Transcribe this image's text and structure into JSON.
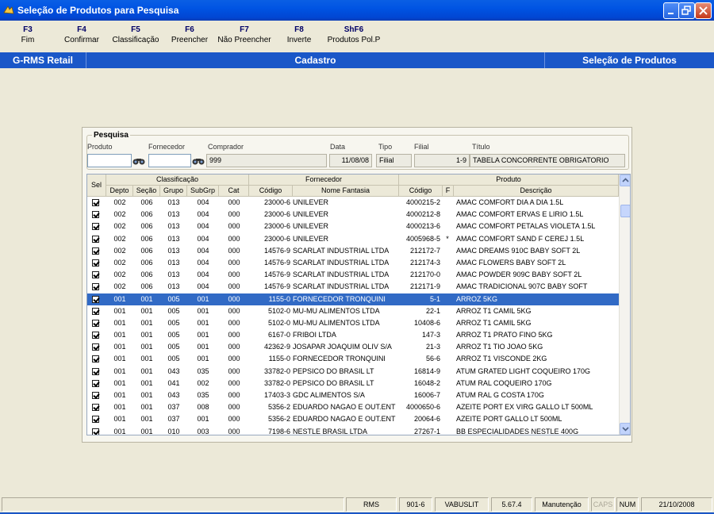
{
  "window": {
    "title": "Seleção de Produtos para Pesquisa"
  },
  "toolbar": [
    {
      "key": "F3",
      "label": "Fim"
    },
    {
      "key": "F4",
      "label": "Confirmar"
    },
    {
      "key": "F5",
      "label": "Classificação"
    },
    {
      "key": "F6",
      "label": "Preencher"
    },
    {
      "key": "F7",
      "label": "Não Preencher"
    },
    {
      "key": "F8",
      "label": "Inverte"
    },
    {
      "key": "ShF6",
      "label": "Produtos Pol.P"
    }
  ],
  "header": {
    "left": "G-RMS Retail",
    "middle": "Cadastro",
    "right": "Seleção de Produtos"
  },
  "pesquisa": {
    "title": "Pesquisa",
    "labels": {
      "produto": "Produto",
      "fornecedor": "Fornecedor",
      "comprador": "Comprador",
      "data": "Data",
      "tipo": "Tipo",
      "filial": "Filial",
      "titulo": "Título"
    },
    "values": {
      "produto": "",
      "fornecedor": "",
      "comprador": "999",
      "data": "11/08/08",
      "tipo": "Filial",
      "filial": "1-9",
      "titulo": "TABELA CONCORRENTE OBRIGATORIO"
    }
  },
  "grid": {
    "groups": {
      "sel": "Sel",
      "classificacao": "Classificação",
      "fornecedor": "Fornecedor",
      "produto": "Produto"
    },
    "columns": {
      "depto": "Depto",
      "secao": "Seção",
      "grupo": "Grupo",
      "subgrp": "SubGrp",
      "cat": "Cat",
      "codigo": "Código",
      "nome": "Nome Fantasia",
      "pcodigo": "Código",
      "f": "F",
      "descricao": "Descrição"
    },
    "rows": [
      {
        "depto": "002",
        "secao": "006",
        "grupo": "013",
        "subgrp": "004",
        "cat": "000",
        "codigo": "23000-6",
        "nome": "UNILEVER",
        "pcodigo": "4000215-2",
        "f": "",
        "descricao": "AMAC COMFORT DIA A DIA 1.5L"
      },
      {
        "depto": "002",
        "secao": "006",
        "grupo": "013",
        "subgrp": "004",
        "cat": "000",
        "codigo": "23000-6",
        "nome": "UNILEVER",
        "pcodigo": "4000212-8",
        "f": "",
        "descricao": "AMAC COMFORT ERVAS E LIRIO 1.5L"
      },
      {
        "depto": "002",
        "secao": "006",
        "grupo": "013",
        "subgrp": "004",
        "cat": "000",
        "codigo": "23000-6",
        "nome": "UNILEVER",
        "pcodigo": "4000213-6",
        "f": "",
        "descricao": "AMAC COMFORT PETALAS VIOLETA 1.5L"
      },
      {
        "depto": "002",
        "secao": "006",
        "grupo": "013",
        "subgrp": "004",
        "cat": "000",
        "codigo": "23000-6",
        "nome": "UNILEVER",
        "pcodigo": "4005968-5",
        "f": "*",
        "descricao": "AMAC COMFORT SAND F CEREJ 1.5L"
      },
      {
        "depto": "002",
        "secao": "006",
        "grupo": "013",
        "subgrp": "004",
        "cat": "000",
        "codigo": "14576-9",
        "nome": "SCARLAT INDUSTRIAL LTDA",
        "pcodigo": "212172-7",
        "f": "",
        "descricao": "AMAC DREAMS 910C BABY SOFT 2L"
      },
      {
        "depto": "002",
        "secao": "006",
        "grupo": "013",
        "subgrp": "004",
        "cat": "000",
        "codigo": "14576-9",
        "nome": "SCARLAT INDUSTRIAL LTDA",
        "pcodigo": "212174-3",
        "f": "",
        "descricao": "AMAC FLOWERS BABY SOFT 2L"
      },
      {
        "depto": "002",
        "secao": "006",
        "grupo": "013",
        "subgrp": "004",
        "cat": "000",
        "codigo": "14576-9",
        "nome": "SCARLAT INDUSTRIAL LTDA",
        "pcodigo": "212170-0",
        "f": "",
        "descricao": "AMAC POWDER 909C BABY SOFT 2L"
      },
      {
        "depto": "002",
        "secao": "006",
        "grupo": "013",
        "subgrp": "004",
        "cat": "000",
        "codigo": "14576-9",
        "nome": "SCARLAT INDUSTRIAL LTDA",
        "pcodigo": "212171-9",
        "f": "",
        "descricao": "AMAC TRADICIONAL 907C BABY SOFT"
      },
      {
        "depto": "001",
        "secao": "001",
        "grupo": "005",
        "subgrp": "001",
        "cat": "000",
        "codigo": "1155-0",
        "nome": "FORNECEDOR TRONQUINI",
        "pcodigo": "5-1",
        "f": "",
        "descricao": "ARROZ 5KG"
      },
      {
        "depto": "001",
        "secao": "001",
        "grupo": "005",
        "subgrp": "001",
        "cat": "000",
        "codigo": "5102-0",
        "nome": "MU-MU ALIMENTOS LTDA",
        "pcodigo": "22-1",
        "f": "",
        "descricao": "ARROZ T1 CAMIL 5KG"
      },
      {
        "depto": "001",
        "secao": "001",
        "grupo": "005",
        "subgrp": "001",
        "cat": "000",
        "codigo": "5102-0",
        "nome": "MU-MU ALIMENTOS LTDA",
        "pcodigo": "10408-6",
        "f": "",
        "descricao": "ARROZ T1 CAMIL 5KG"
      },
      {
        "depto": "001",
        "secao": "001",
        "grupo": "005",
        "subgrp": "001",
        "cat": "000",
        "codigo": "6167-0",
        "nome": "FRIBOI LTDA",
        "pcodigo": "147-3",
        "f": "",
        "descricao": "ARROZ T1 PRATO FINO 5KG"
      },
      {
        "depto": "001",
        "secao": "001",
        "grupo": "005",
        "subgrp": "001",
        "cat": "000",
        "codigo": "42362-9",
        "nome": "JOSAPAR JOAQUIM OLIV S/A",
        "pcodigo": "21-3",
        "f": "",
        "descricao": "ARROZ T1 TIO JOAO 5KG"
      },
      {
        "depto": "001",
        "secao": "001",
        "grupo": "005",
        "subgrp": "001",
        "cat": "000",
        "codigo": "1155-0",
        "nome": "FORNECEDOR TRONQUINI",
        "pcodigo": "56-6",
        "f": "",
        "descricao": "ARROZ T1 VISCONDE 2KG"
      },
      {
        "depto": "001",
        "secao": "001",
        "grupo": "043",
        "subgrp": "035",
        "cat": "000",
        "codigo": "33782-0",
        "nome": "PEPSICO DO BRASIL LT",
        "pcodigo": "16814-9",
        "f": "",
        "descricao": "ATUM GRATED LIGHT COQUEIRO 170G"
      },
      {
        "depto": "001",
        "secao": "001",
        "grupo": "041",
        "subgrp": "002",
        "cat": "000",
        "codigo": "33782-0",
        "nome": "PEPSICO DO BRASIL LT",
        "pcodigo": "16048-2",
        "f": "",
        "descricao": "ATUM RAL COQUEIRO 170G"
      },
      {
        "depto": "001",
        "secao": "001",
        "grupo": "043",
        "subgrp": "035",
        "cat": "000",
        "codigo": "17403-3",
        "nome": "GDC ALIMENTOS S/A",
        "pcodigo": "16006-7",
        "f": "",
        "descricao": "ATUM RAL G COSTA 170G"
      },
      {
        "depto": "001",
        "secao": "001",
        "grupo": "037",
        "subgrp": "008",
        "cat": "000",
        "codigo": "5356-2",
        "nome": "EDUARDO NAGAO E OUT.ENT",
        "pcodigo": "4000650-6",
        "f": "",
        "descricao": "AZEITE PORT EX VIRG GALLO LT 500ML"
      },
      {
        "depto": "001",
        "secao": "001",
        "grupo": "037",
        "subgrp": "001",
        "cat": "000",
        "codigo": "5356-2",
        "nome": "EDUARDO NAGAO E OUT.ENT",
        "pcodigo": "20064-6",
        "f": "",
        "descricao": "AZEITE PORT GALLO LT 500ML"
      },
      {
        "depto": "001",
        "secao": "001",
        "grupo": "010",
        "subgrp": "003",
        "cat": "000",
        "codigo": "7198-6",
        "nome": "NESTLE BRASIL LTDA",
        "pcodigo": "27267-1",
        "f": "",
        "descricao": "BB ESPECIALIDADES NESTLE 400G"
      }
    ]
  },
  "statusbar": {
    "system": "RMS",
    "code": "901-6",
    "user": "VABUSLIT",
    "version": "5.67.4",
    "mode": "Manutenção",
    "caps": "CAPS",
    "num": "NUM",
    "date": "21/10/2008"
  },
  "colors": {
    "title_blue": "#0054E3",
    "header_blue": "#1A57C8",
    "selection": "#316AC5"
  }
}
